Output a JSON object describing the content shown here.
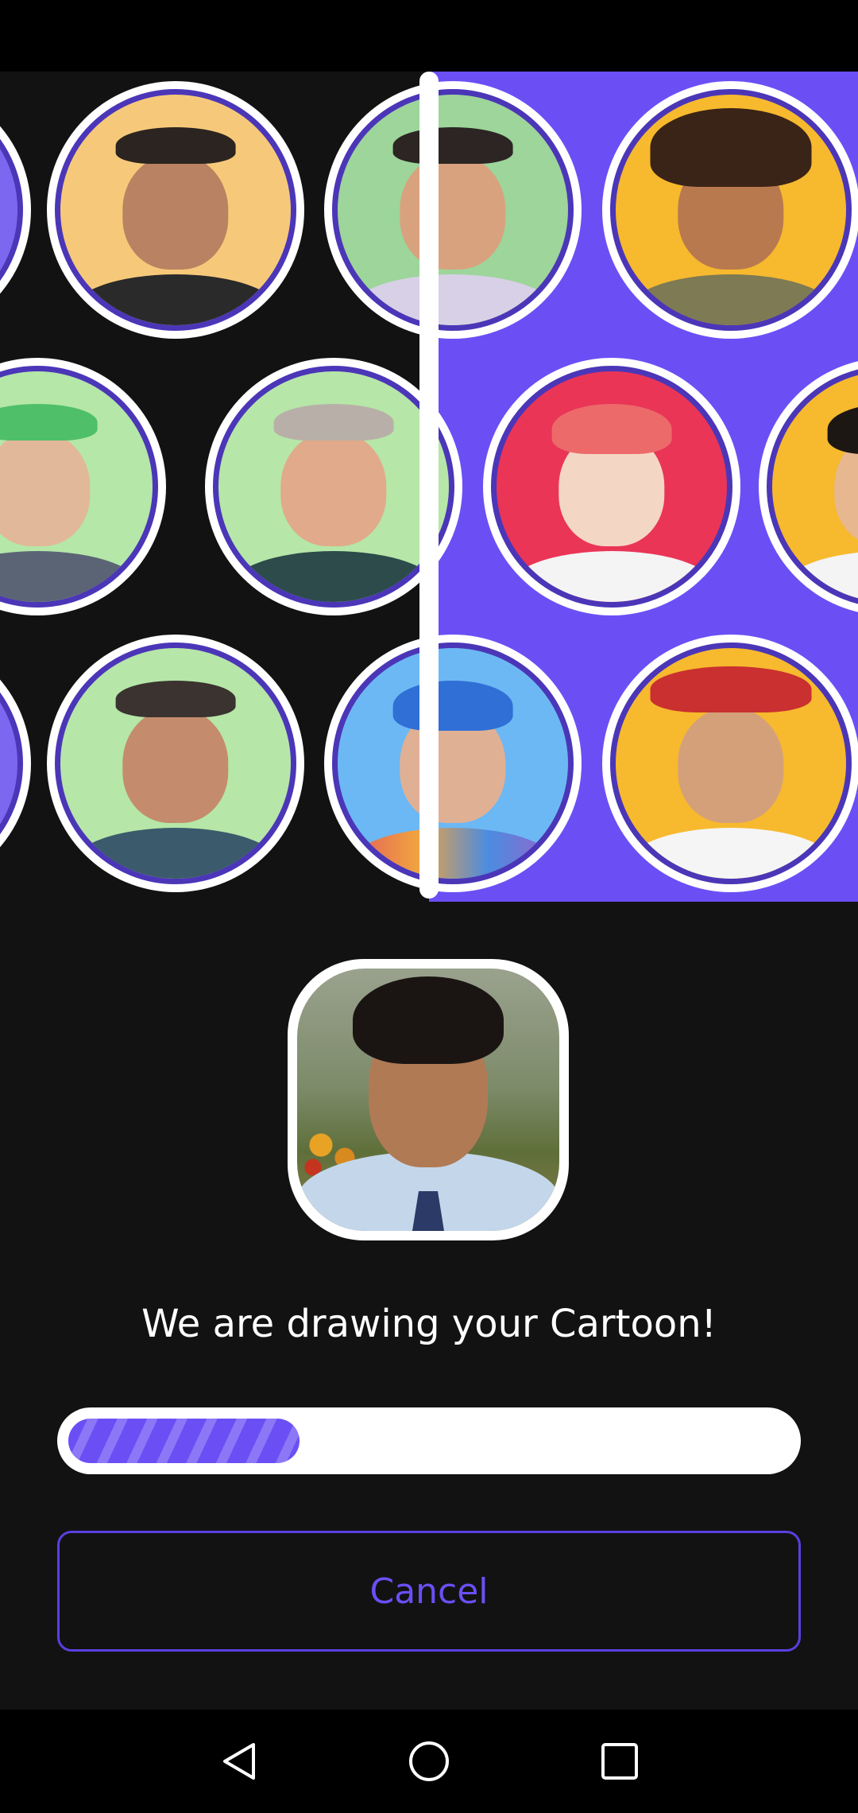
{
  "headline": "We are drawing your Cartoon!",
  "progress": {
    "fraction": 0.32
  },
  "cancel_label": "Cancel",
  "colors": {
    "accent": "#6B4FF5",
    "background": "#121212",
    "ring": "#4B36B8"
  },
  "nav": {
    "back_icon": "back-triangle-icon",
    "home_icon": "home-circle-icon",
    "recents_icon": "recents-square-icon"
  }
}
